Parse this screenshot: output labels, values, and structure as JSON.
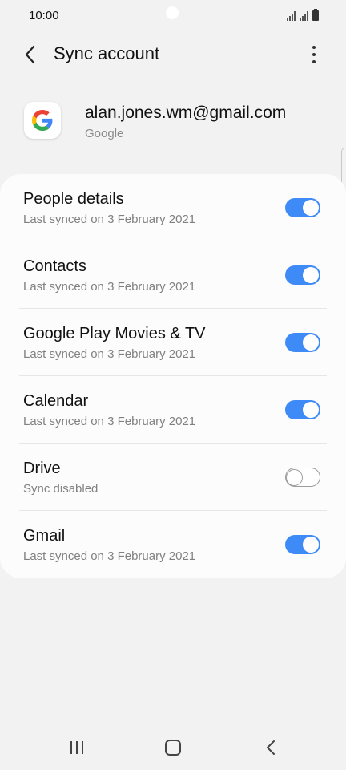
{
  "status_bar": {
    "time": "10:00"
  },
  "app_bar": {
    "title": "Sync account",
    "back_icon": "chevron-left-icon",
    "more_icon": "more-vertical-icon"
  },
  "account": {
    "email": "alan.jones.wm@gmail.com",
    "type": "Google",
    "icon": "google-logo-icon"
  },
  "sync_items": [
    {
      "label": "People details",
      "status": "Last synced on 3 February 2021",
      "enabled": true
    },
    {
      "label": "Contacts",
      "status": "Last synced on 3 February 2021",
      "enabled": true
    },
    {
      "label": "Google Play Movies & TV",
      "status": "Last synced on 3 February 2021",
      "enabled": true
    },
    {
      "label": "Calendar",
      "status": "Last synced on 3 February 2021",
      "enabled": true
    },
    {
      "label": "Drive",
      "status": "Sync disabled",
      "enabled": false
    },
    {
      "label": "Gmail",
      "status": "Last synced on 3 February 2021",
      "enabled": true
    }
  ],
  "nav_bar": {
    "recent_icon": "recent-apps-icon",
    "home_icon": "home-icon",
    "back_icon": "back-icon"
  },
  "colors": {
    "toggle_on": "#3e8af7",
    "background": "#f2f2f2",
    "card": "#fcfcfc"
  }
}
